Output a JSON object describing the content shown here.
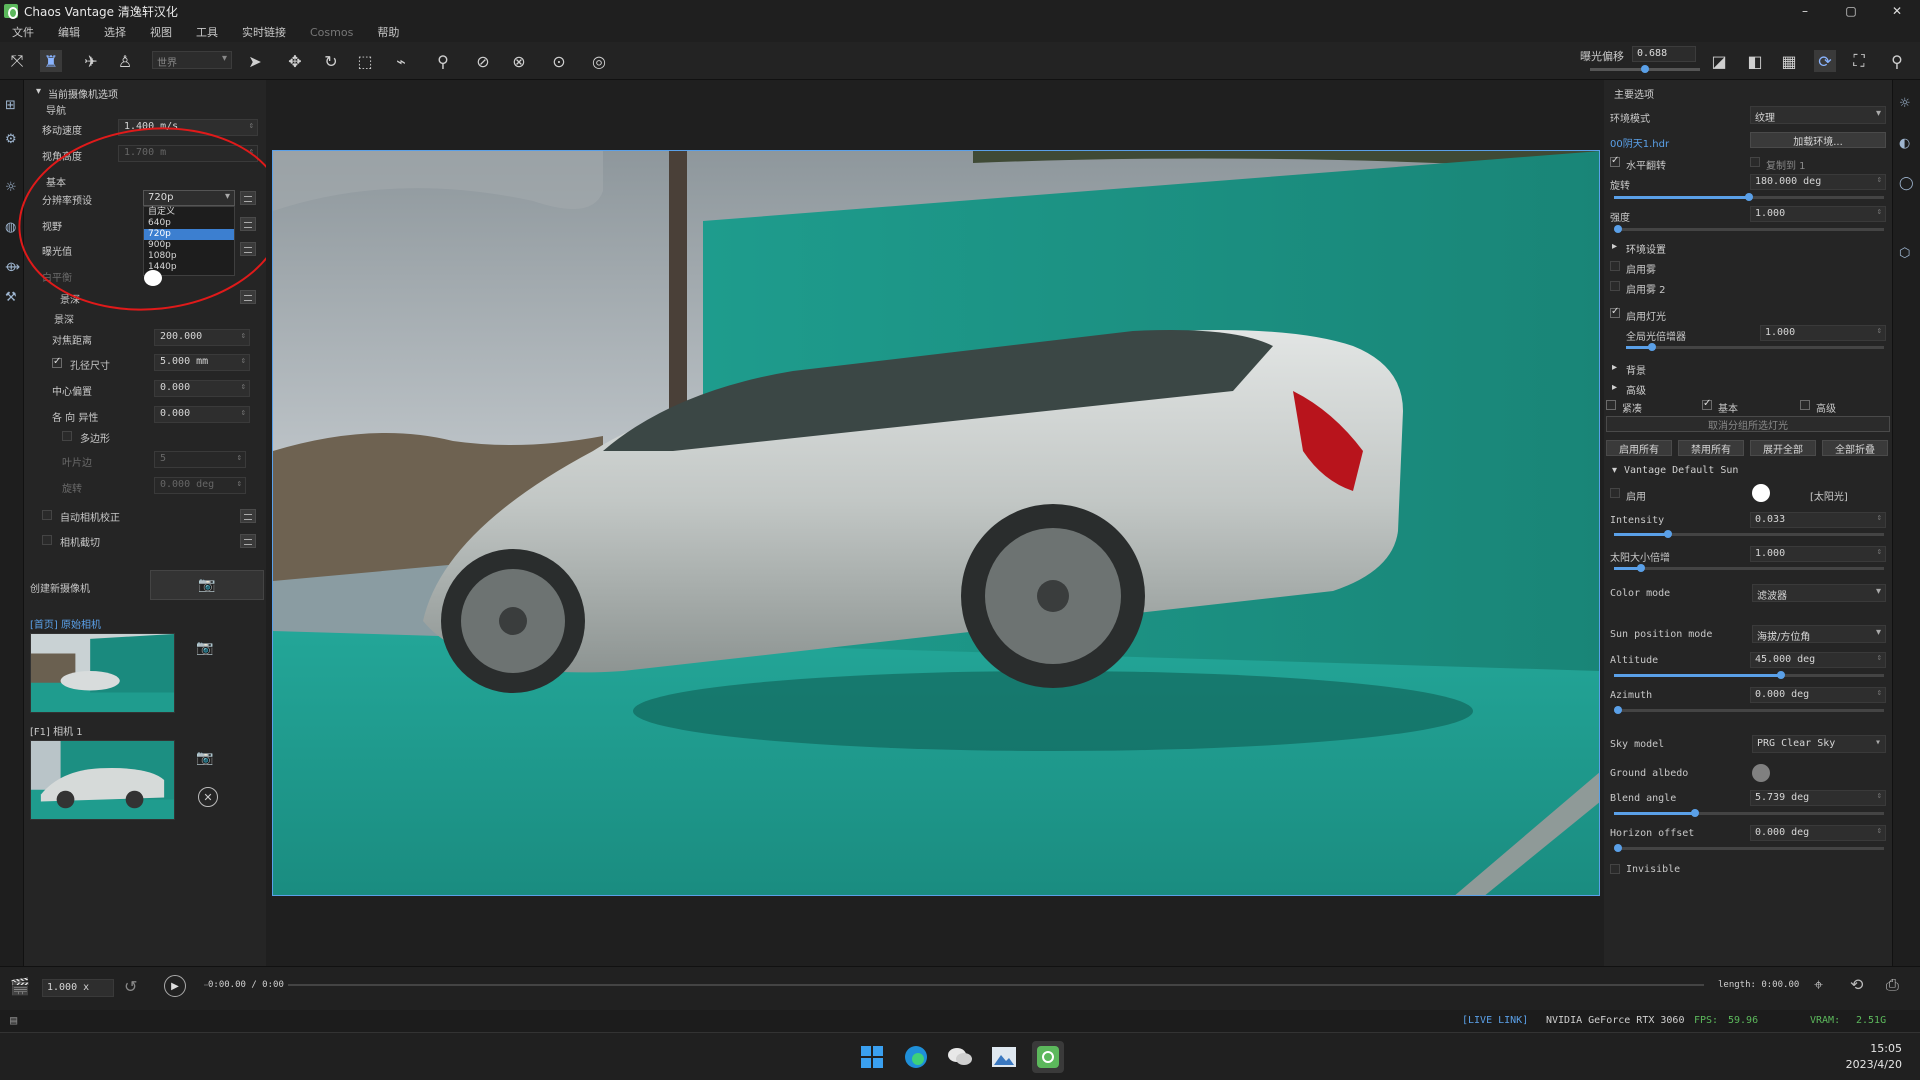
{
  "window": {
    "title": "Chaos Vantage 清逸轩汉化",
    "min": "–",
    "max": "▢",
    "close": "✕"
  },
  "menu": [
    "文件",
    "编辑",
    "选择",
    "视图",
    "工具",
    "实时链接",
    "Cosmos",
    "帮助"
  ],
  "toolbar": {
    "space_select": "世界",
    "exposure_label": "曝光偏移",
    "exposure_value": "0.688",
    "exposure_level": 0.5
  },
  "left_panel": {
    "section_title": "当前摄像机选项",
    "nav_title": "导航",
    "move_speed_label": "移动速度",
    "move_speed_value": "1.400 m/s",
    "view_height_label": "视角高度",
    "view_height_value": "1.700 m",
    "basic_title": "基本",
    "resolution_label": "分辨率预设",
    "resolution_value": "720p",
    "resolution_options": [
      "自定义",
      "640p",
      "720p",
      "900p",
      "1080p",
      "1440p"
    ],
    "resolution_selected_index": 2,
    "fov_label": "视野",
    "exposure_label": "曝光值",
    "white_balance_label": "白平衡",
    "dof_label": "景深",
    "dof_sub": "景深",
    "focus_dist_label": "对焦距离",
    "focus_dist_value": "200.000",
    "aperture_label": "孔径尺寸",
    "aperture_value": "5.000 mm",
    "aperture_checked": true,
    "center_bias_label": "中心偏置",
    "center_bias_value": "0.000",
    "anisotropy_label": "各 向 异性",
    "anisotropy_value": "0.000",
    "polygon_label": "多边形",
    "blades_label": "叶片边",
    "blades_value": "5",
    "rotation_label": "旋转",
    "rotation_value": "0.000 deg",
    "auto_correct_label": "自动相机校正",
    "camera_clip_label": "相机截切",
    "create_camera_label": "创建新摄像机",
    "cameras": [
      {
        "title": "[首页] 原始相机"
      },
      {
        "title": "[F1] 相机 1"
      }
    ]
  },
  "right_panel": {
    "main_options": "主要选项",
    "env_mode_label": "环境模式",
    "env_mode_value": "纹理",
    "hdr_file": "00阴天1.hdr",
    "load_env": "加载环境...",
    "flip_h_label": "水平翻转",
    "flip_h_checked": true,
    "copy_to_label": "复制到 1",
    "rotation_label": "旋转",
    "rotation_value": "180.000 deg",
    "rotation_level": 0.5,
    "intensity_label": "强度",
    "intensity_value": "1.000",
    "intensity_level": 0.0,
    "env_settings": "环境设置",
    "enable_fog": "启用雾",
    "enable_fog2": "启用雾 2",
    "enable_lights": "启用灯光",
    "enable_lights_checked": true,
    "global_light_mult_label": "全局光倍增器",
    "global_light_mult_value": "1.000",
    "global_light_level": 0.1,
    "background": "背景",
    "advanced": "高级",
    "tabs": [
      "紧凑",
      "基本",
      "高级"
    ],
    "tab_basic_checked": true,
    "unselect_all_lights": "取消分组所选灯光",
    "btn_enable_all": "启用所有",
    "btn_disable_all": "禁用所有",
    "btn_expand_all": "展开全部",
    "btn_collapse_all": "全部折叠",
    "sun_title": "Vantage Default Sun",
    "sun_enable": "启用",
    "sun_tag": "[太阳光]",
    "intensity2_label": "Intensity",
    "intensity2_value": "0.033",
    "intensity2_level": 0.2,
    "sun_size_label": "太阳大小倍增",
    "sun_size_value": "1.000",
    "sun_size_level": 0.1,
    "color_mode_label": "Color mode",
    "color_mode_value": "滤波器",
    "sun_pos_mode_label": "Sun position mode",
    "sun_pos_mode_value": "海拔/方位角",
    "altitude_label": "Altitude",
    "altitude_value": "45.000 deg",
    "altitude_level": 0.62,
    "azimuth_label": "Azimuth",
    "azimuth_value": "0.000 deg",
    "azimuth_level": 0.0,
    "sky_model_label": "Sky model",
    "sky_model_value": "PRG Clear Sky",
    "ground_albedo_label": "Ground albedo",
    "blend_angle_label": "Blend angle",
    "blend_angle_value": "5.739 deg",
    "blend_level": 0.3,
    "horizon_offset_label": "Horizon offset",
    "horizon_offset_value": "0.000 deg",
    "horizon_level": 0.0,
    "invisible_label": "Invisible"
  },
  "timeline": {
    "speed": "1.000 x",
    "time": "0:00.00 / 0:00",
    "length": "length: 0:00.00"
  },
  "status": {
    "live_link": "[LIVE LINK]",
    "gpu": "NVIDIA GeForce RTX 3060",
    "fps_label": "FPS:",
    "fps": "59.96",
    "vram_label": "VRAM:",
    "vram": "2.51G"
  },
  "clock": {
    "time": "15:05",
    "date": "2023/4/20"
  },
  "colors": {
    "accent": "#5aa0e8",
    "annotation": "#e01a1a",
    "teal": "#1f9c8e"
  }
}
